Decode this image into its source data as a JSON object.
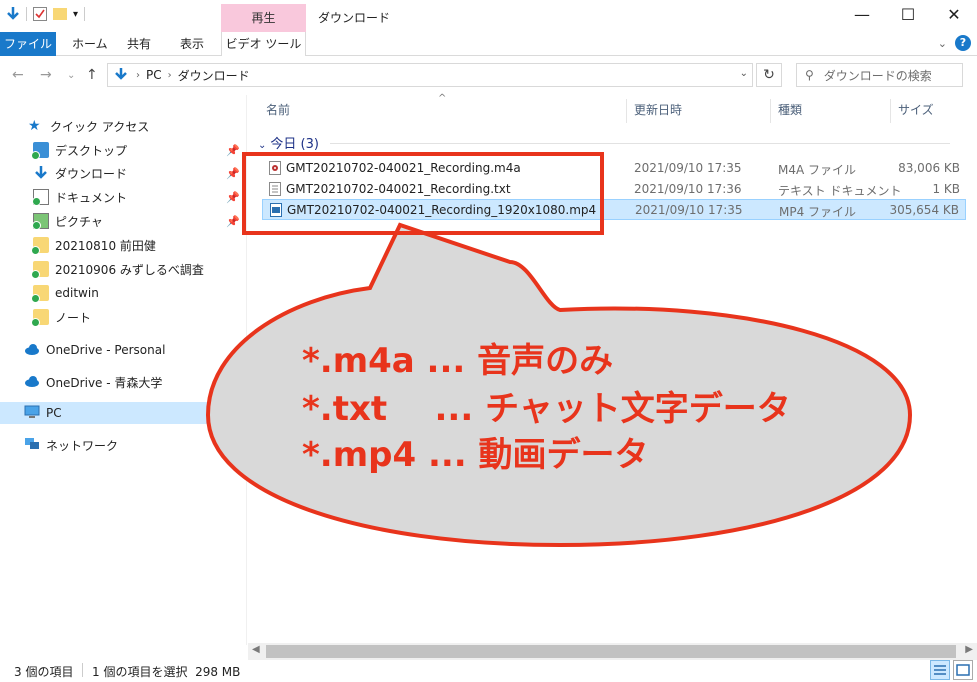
{
  "window": {
    "context_tab": "再生",
    "title": "ダウンロード",
    "minimize": "—",
    "maximize": "☐",
    "close": "✕"
  },
  "ribbon": {
    "file": "ファイル",
    "home": "ホーム",
    "share": "共有",
    "view": "表示",
    "video_tools": "ビデオ ツール",
    "help": "?"
  },
  "address": {
    "crumbs": [
      "PC",
      "ダウンロード"
    ],
    "search_placeholder": "ダウンロードの検索"
  },
  "navpane": {
    "quick_access": "クイック アクセス",
    "items": [
      {
        "label": "デスクトップ",
        "pinned": true
      },
      {
        "label": "ダウンロード",
        "pinned": true
      },
      {
        "label": "ドキュメント",
        "pinned": true
      },
      {
        "label": "ピクチャ",
        "pinned": true
      },
      {
        "label": "20210810 前田健"
      },
      {
        "label": "20210906 みずしるべ調査"
      },
      {
        "label": "editwin"
      },
      {
        "label": "ノート"
      }
    ],
    "onedrive_personal": "OneDrive - Personal",
    "onedrive_org": "OneDrive - 青森大学",
    "pc": "PC",
    "network": "ネットワーク"
  },
  "columns": {
    "name": "名前",
    "date": "更新日時",
    "type": "種類",
    "size": "サイズ"
  },
  "group": {
    "label": "今日 (3)"
  },
  "files": [
    {
      "name": "GMT20210702-040021_Recording.m4a",
      "date": "2021/09/10 17:35",
      "type": "M4A ファイル",
      "size": "83,006 KB"
    },
    {
      "name": "GMT20210702-040021_Recording.txt",
      "date": "2021/09/10 17:36",
      "type": "テキスト ドキュメント",
      "size": "1 KB"
    },
    {
      "name": "GMT20210702-040021_Recording_1920x1080.mp4",
      "date": "2021/09/10 17:35",
      "type": "MP4 ファイル",
      "size": "305,654 KB"
    }
  ],
  "status": {
    "count": "3 個の項目",
    "selection": "1 個の項目を選択  298 MB"
  },
  "annotation": {
    "line1": "*.m4a ... 音声のみ",
    "line2": "*.txt    ... チャット文字データ",
    "line3": "*.mp4 ... 動画データ",
    "color": "#e8341c"
  }
}
